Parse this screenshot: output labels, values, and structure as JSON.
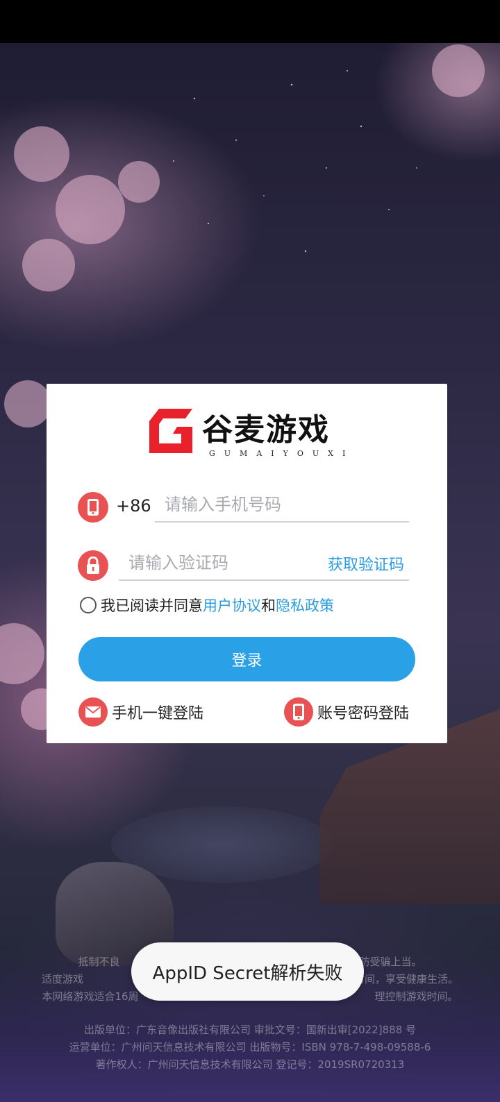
{
  "brand": {
    "name": "谷麦游戏",
    "subtitle": "GUMAIYOUXI",
    "accent": "#e8212b"
  },
  "login": {
    "country_code": "+86",
    "phone_placeholder": "请输入手机号码",
    "code_placeholder": "请输入验证码",
    "get_code_label": "获取验证码",
    "agree_prefix": "我已阅读并同意",
    "user_agreement": "用户协议",
    "agree_and": "和",
    "privacy_policy": "隐私政策",
    "login_button": "登录",
    "alt_phone_login": "手机一键登陆",
    "alt_account_login": "账号密码登陆"
  },
  "icons": {
    "phone": "phone-icon",
    "lock": "lock-icon",
    "mail": "mail-icon",
    "account": "phone-icon"
  },
  "colors": {
    "icon_bg": "#e85252",
    "link": "#2b9ce0",
    "button": "#2aa0e6"
  },
  "footer": {
    "line1_left": "抵制不良",
    "line1_right": "谨防受骗上当。",
    "line2_left": "适度游戏",
    "line2_right": "合理安排时间，享受健康生活。",
    "line3_left": "本网络游戏适合16周",
    "line3_right": "理控制游戏时间。",
    "line4": "出版单位：广东音像出版社有限公司  审批文号：国新出审[2022]888 号",
    "line5": "运营单位：广州问天信息技术有限公司  出版物号：ISBN 978-7-498-09588-6",
    "line6": "著作权人：广州问天信息技术有限公司  登记号：2019SR0720313"
  },
  "toast": "AppID Secret解析失败"
}
